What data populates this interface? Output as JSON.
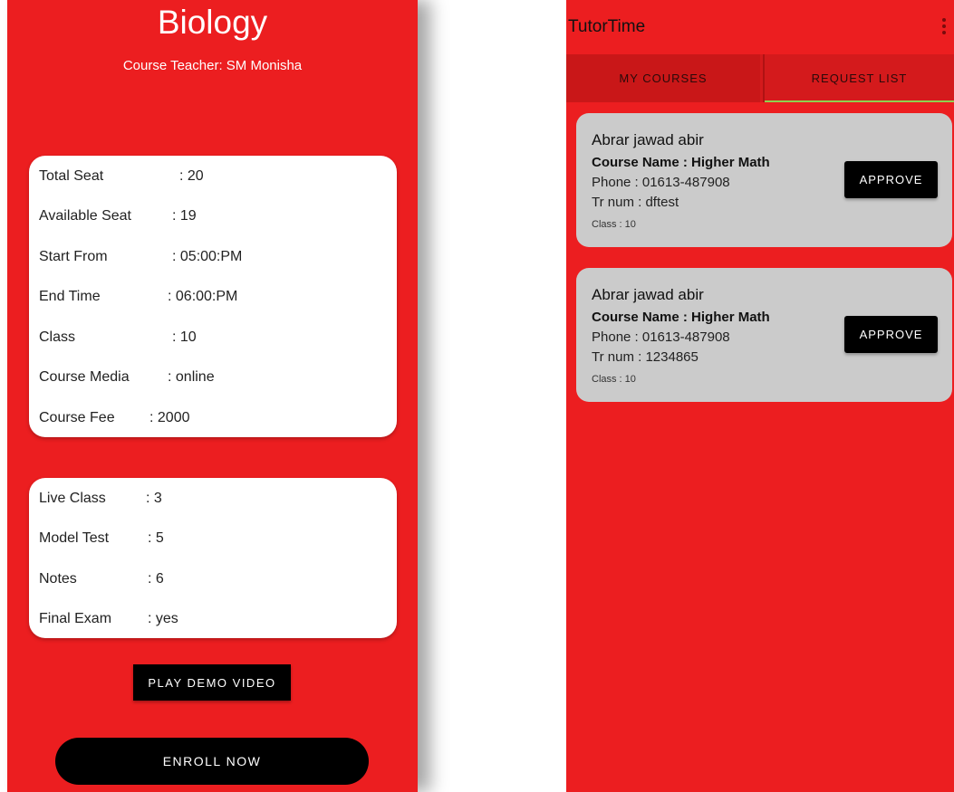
{
  "left_screen": {
    "title": "Biology",
    "teacher": "Course Teacher: SM Monisha",
    "details": [
      {
        "label": "Total Seat",
        "value": ":  20"
      },
      {
        "label": "Available Seat",
        "value": ":  19"
      },
      {
        "label": "Start From",
        "value": ":  05:00:PM"
      },
      {
        "label": "End Time",
        "value": ":  06:00:PM"
      },
      {
        "label": "Class",
        "value": ":  10"
      },
      {
        "label": "Course Media",
        "value": ":  online"
      },
      {
        "label": "Course Fee",
        "value": ":  2000"
      }
    ],
    "extras": [
      {
        "label": "Live Class",
        "value": ":  3"
      },
      {
        "label": "Model Test",
        "value": ":  5"
      },
      {
        "label": "Notes",
        "value": ":  6"
      },
      {
        "label": "Final Exam",
        "value": ":  yes"
      }
    ],
    "demo_button": "PLAY DEMO VIDEO",
    "enroll_button": "ENROLL NOW"
  },
  "right_screen": {
    "app_title": "TutorTime",
    "menu_icon": "more-vert-icon",
    "tabs": [
      {
        "label": "MY COURSES",
        "active": false
      },
      {
        "label": "REQUEST LIST",
        "active": true
      }
    ],
    "requests": [
      {
        "name": "Abrar jawad abir",
        "course": "Course Name : Higher Math",
        "phone": "Phone : 01613-487908",
        "tr_num": "Tr num : dftest",
        "class": "Class : 10",
        "button": "APPROVE"
      },
      {
        "name": "Abrar jawad abir",
        "course": "Course Name : Higher Math",
        "phone": "Phone : 01613-487908",
        "tr_num": "Tr num : 1234865",
        "class": "Class : 10",
        "button": "APPROVE"
      }
    ]
  },
  "colors": {
    "background_red": "#ec1e20",
    "tab_active_indicator": "#8fd14f",
    "card_gray": "#cbcbcb"
  }
}
